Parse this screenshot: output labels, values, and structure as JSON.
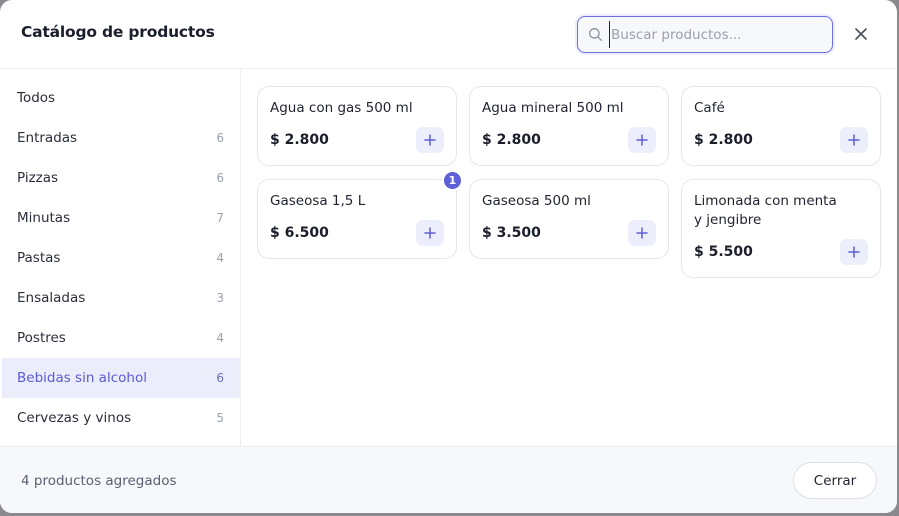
{
  "modal": {
    "title": "Catálogo de productos",
    "search": {
      "placeholder": "Buscar productos...",
      "value": ""
    },
    "close_icon": "close-icon"
  },
  "sidebar": {
    "categories": [
      {
        "label": "Todos",
        "count": ""
      },
      {
        "label": "Entradas",
        "count": "6"
      },
      {
        "label": "Pizzas",
        "count": "6"
      },
      {
        "label": "Minutas",
        "count": "7"
      },
      {
        "label": "Pastas",
        "count": "4"
      },
      {
        "label": "Ensaladas",
        "count": "3"
      },
      {
        "label": "Postres",
        "count": "4"
      },
      {
        "label": "Bebidas sin alcohol",
        "count": "6",
        "active": true
      },
      {
        "label": "Cervezas y vinos",
        "count": "5"
      }
    ]
  },
  "products": [
    {
      "name": "Agua con gas 500 ml",
      "price": "$ 2.800",
      "add_icon": "plus-icon"
    },
    {
      "name": "Agua mineral 500 ml",
      "price": "$ 2.800",
      "add_icon": "plus-icon"
    },
    {
      "name": "Café",
      "price": "$ 2.800",
      "add_icon": "plus-icon"
    },
    {
      "name": "Gaseosa 1,5 L",
      "price": "$ 6.500",
      "add_icon": "plus-icon",
      "badge": "1"
    },
    {
      "name": "Gaseosa 500 ml",
      "price": "$ 3.500",
      "add_icon": "plus-icon"
    },
    {
      "name": "Limonada con menta y jengibre",
      "price": "$ 5.500",
      "add_icon": "plus-icon"
    }
  ],
  "footer": {
    "summary": "4 productos agregados",
    "close_label": "Cerrar"
  },
  "colors": {
    "accent": "#5f60d8",
    "accent_soft": "#ecedfb",
    "text": "#1f2330",
    "muted": "#9aa0ad"
  }
}
